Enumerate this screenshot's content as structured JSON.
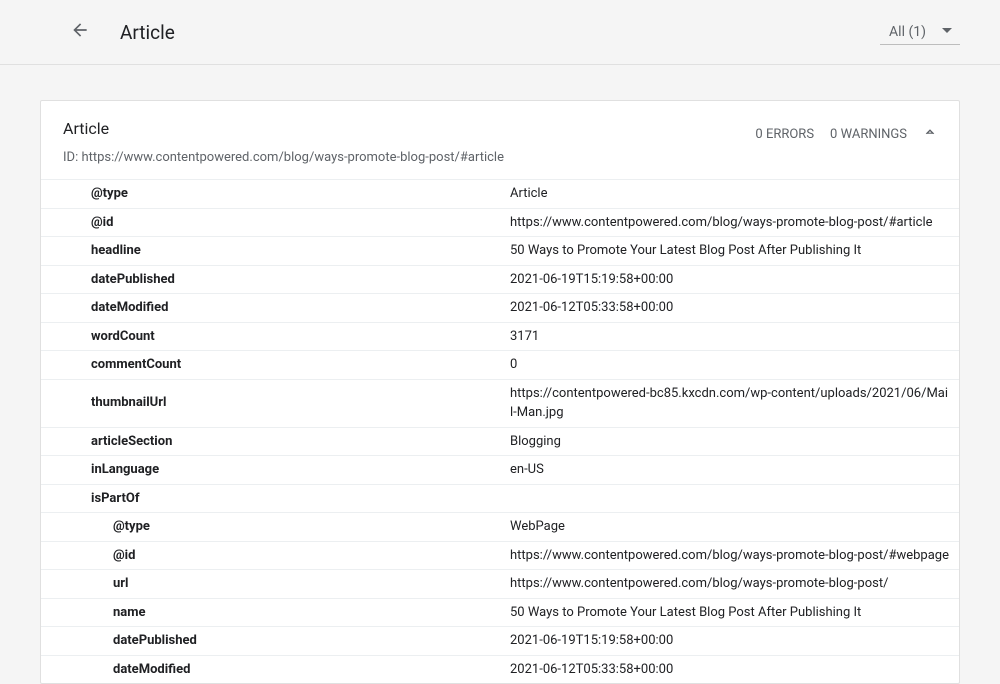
{
  "header": {
    "title": "Article",
    "filter_label": "All (1)"
  },
  "card": {
    "title": "Article",
    "id_prefix": "ID: ",
    "id_value": "https://www.contentpowered.com/blog/ways-promote-blog-post/#article",
    "errors_label": "0 ERRORS",
    "warnings_label": "0 WARNINGS"
  },
  "rows": [
    {
      "key": "@type",
      "val": "Article",
      "indent": 1
    },
    {
      "key": "@id",
      "val": "https://www.contentpowered.com/blog/ways-promote-blog-post/#article",
      "indent": 1
    },
    {
      "key": "headline",
      "val": "50 Ways to Promote Your Latest Blog Post After Publishing It",
      "indent": 1
    },
    {
      "key": "datePublished",
      "val": "2021-06-19T15:19:58+00:00",
      "indent": 1
    },
    {
      "key": "dateModified",
      "val": "2021-06-12T05:33:58+00:00",
      "indent": 1
    },
    {
      "key": "wordCount",
      "val": "3171",
      "indent": 1
    },
    {
      "key": "commentCount",
      "val": "0",
      "indent": 1
    },
    {
      "key": "thumbnailUrl",
      "val": "https://contentpowered-bc85.kxcdn.com/wp-content/uploads/2021/06/Mail-Man.jpg",
      "indent": 1
    },
    {
      "key": "articleSection",
      "val": "Blogging",
      "indent": 1
    },
    {
      "key": "inLanguage",
      "val": "en-US",
      "indent": 1
    },
    {
      "key": "isPartOf",
      "val": "",
      "indent": 1
    },
    {
      "key": "@type",
      "val": "WebPage",
      "indent": 2
    },
    {
      "key": "@id",
      "val": "https://www.contentpowered.com/blog/ways-promote-blog-post/#webpage",
      "indent": 2
    },
    {
      "key": "url",
      "val": "https://www.contentpowered.com/blog/ways-promote-blog-post/",
      "indent": 2
    },
    {
      "key": "name",
      "val": "50 Ways to Promote Your Latest Blog Post After Publishing It",
      "indent": 2
    },
    {
      "key": "datePublished",
      "val": "2021-06-19T15:19:58+00:00",
      "indent": 2
    },
    {
      "key": "dateModified",
      "val": "2021-06-12T05:33:58+00:00",
      "indent": 2
    }
  ]
}
